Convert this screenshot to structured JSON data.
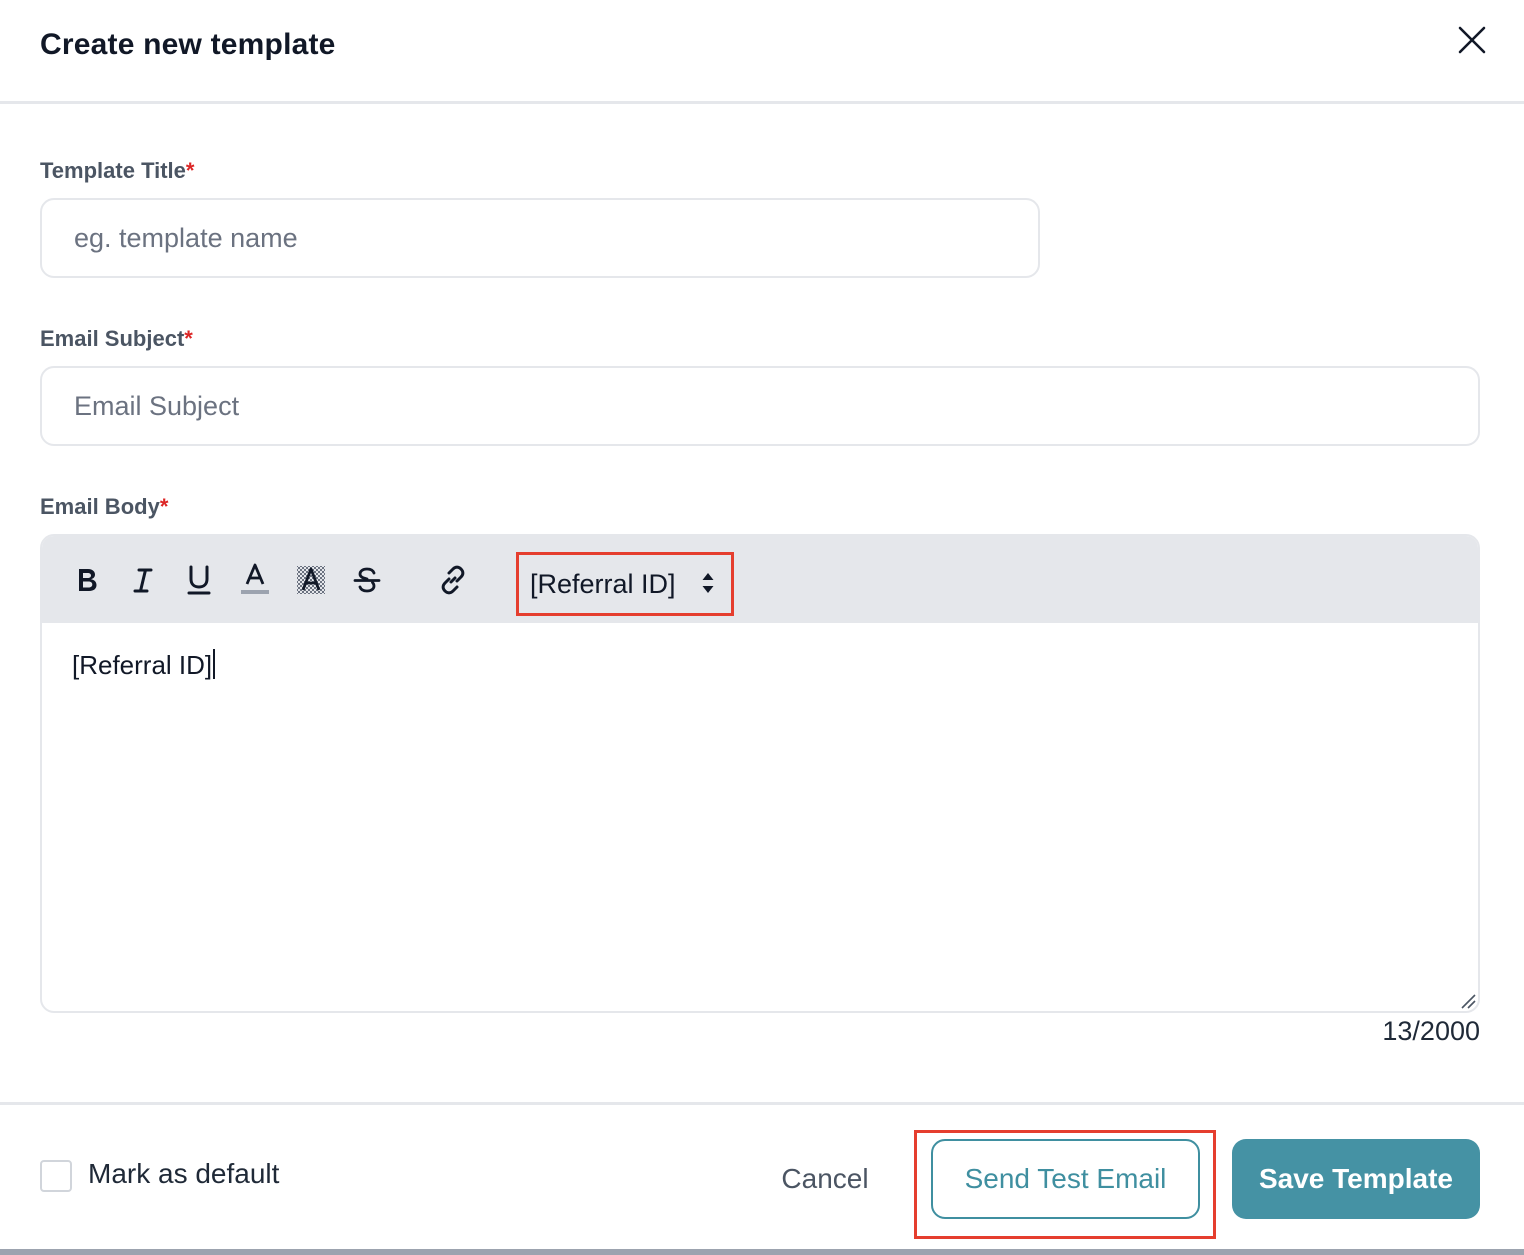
{
  "header": {
    "title": "Create new template",
    "close_icon": "close-icon"
  },
  "form": {
    "template_title": {
      "label": "Template Title",
      "required_mark": "*",
      "placeholder": "eg. template name",
      "value": ""
    },
    "email_subject": {
      "label": "Email Subject",
      "required_mark": "*",
      "placeholder": "Email Subject",
      "value": ""
    },
    "email_body": {
      "label": "Email Body",
      "required_mark": "*",
      "toolbar": {
        "buttons": [
          "bold-icon",
          "italic-icon",
          "underline-icon",
          "text-color-icon",
          "highlight-color-icon",
          "strikethrough-icon",
          "link-icon"
        ],
        "variable_select": "[Referral ID]"
      },
      "content": "[Referral ID]",
      "char_count": "13/2000"
    }
  },
  "footer": {
    "mark_default_label": "Mark as default",
    "mark_default_checked": false,
    "cancel_label": "Cancel",
    "send_test_label": "Send Test Email",
    "save_label": "Save Template"
  },
  "colors": {
    "primary": "#4592a4",
    "required": "#dc2626",
    "highlight_outline": "#e53e2e",
    "toolbar_bg": "#e5e7eb"
  }
}
